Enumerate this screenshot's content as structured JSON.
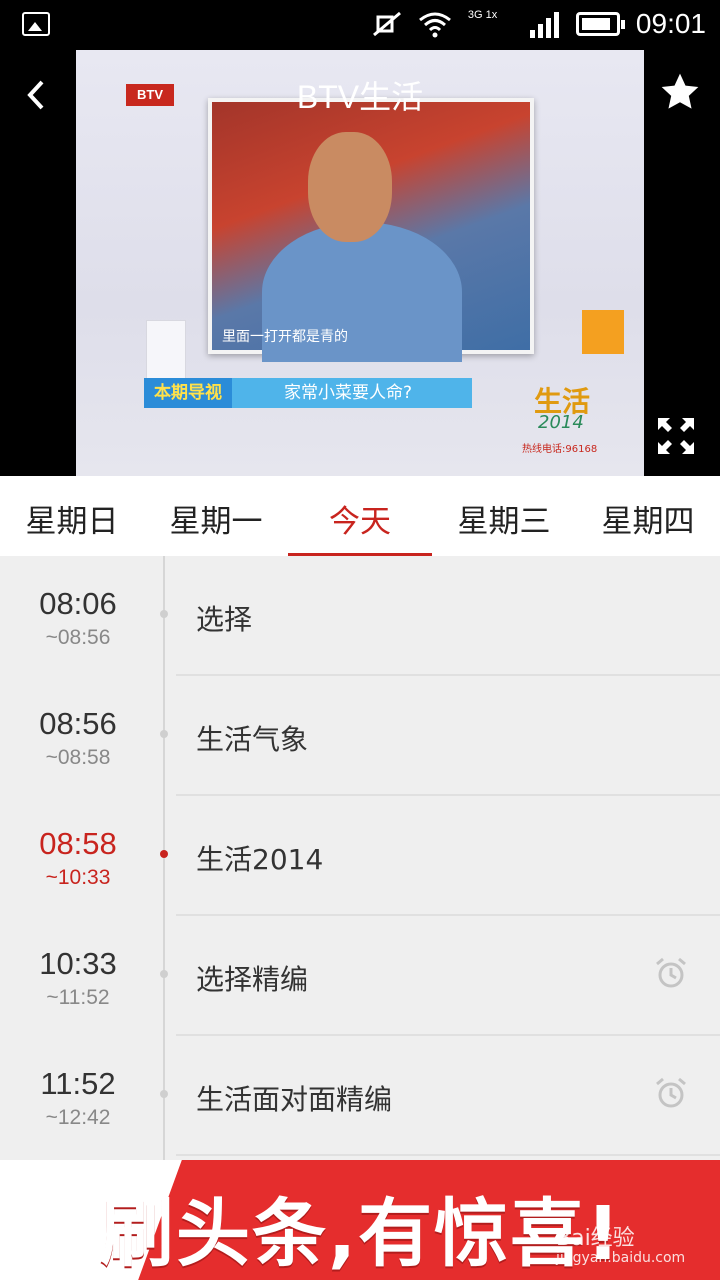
{
  "status_bar": {
    "network": "3G 1x",
    "time": "09:01"
  },
  "player": {
    "title": "BTV生活",
    "video": {
      "logo": "BTV",
      "caption": "里面一打开都是青的",
      "banner_tag": "本期导视",
      "banner_text": "家常小菜要人命?",
      "brand": "生活",
      "brand_sub": "2014",
      "hotline": "热线电话:96168"
    }
  },
  "tabs": [
    {
      "label": "星期日",
      "active": false
    },
    {
      "label": "星期一",
      "active": false
    },
    {
      "label": "今天",
      "active": true
    },
    {
      "label": "星期三",
      "active": false
    },
    {
      "label": "星期四",
      "active": false
    }
  ],
  "schedule": [
    {
      "start": "08:06",
      "end": "~08:56",
      "name": "选择",
      "live": false,
      "alarm": false
    },
    {
      "start": "08:56",
      "end": "~08:58",
      "name": "生活气象",
      "live": false,
      "alarm": false
    },
    {
      "start": "08:58",
      "end": "~10:33",
      "name": "生活2014",
      "live": true,
      "alarm": false
    },
    {
      "start": "10:33",
      "end": "~11:52",
      "name": "选择精编",
      "live": false,
      "alarm": true
    },
    {
      "start": "11:52",
      "end": "~12:42",
      "name": "生活面对面精编",
      "live": false,
      "alarm": true
    }
  ],
  "ad": {
    "text": "刷头条,有惊喜!",
    "watermark": "Bai经验",
    "watermark_url": "jingyan.baidu.com"
  },
  "colors": {
    "accent": "#c8241e",
    "ad_red": "#e52d2d"
  }
}
